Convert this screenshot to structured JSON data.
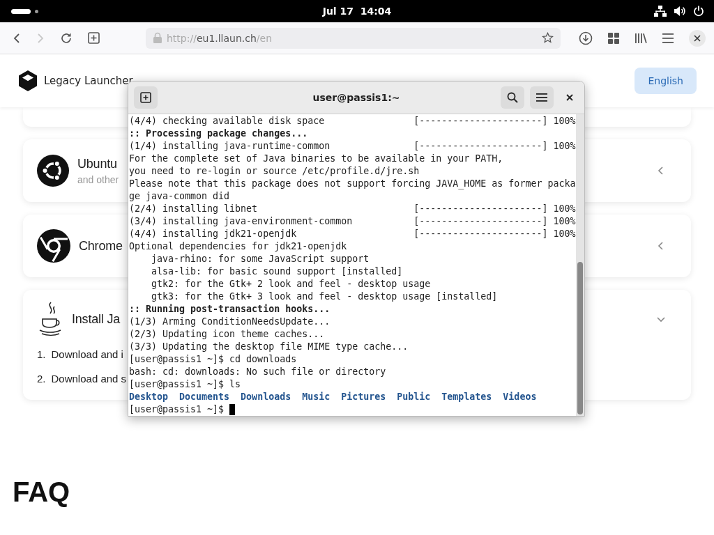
{
  "top_bar": {
    "clock": "Jul 17  14:04"
  },
  "browser": {
    "back_disabled": false,
    "forward_disabled": true,
    "url_scheme": "http://",
    "url_host": "eu1.llaun.ch",
    "url_path": "/en"
  },
  "site": {
    "brand": "Legacy Launcher",
    "language_button": "English",
    "cards": [
      {
        "kind": "ring",
        "title": "Ubuntu",
        "subtitle": "and other",
        "expanded": false
      },
      {
        "kind": "aperture",
        "title": "Chrome",
        "expanded": false
      },
      {
        "kind": "cup",
        "title": "Install Ja",
        "expanded": true,
        "steps": [
          {
            "number": "1.",
            "text": "Download and i"
          },
          {
            "number": "2.",
            "text": "Download and s"
          }
        ]
      }
    ],
    "faq_heading": "FAQ"
  },
  "terminal": {
    "title": "user@passis1:~",
    "lines": [
      {
        "kind": "progress",
        "text": "(4/4) checking available disk space",
        "bar": "[----------------------]",
        "percent": "100%"
      },
      {
        "kind": "bold",
        "text": ":: Processing package changes..."
      },
      {
        "kind": "progress",
        "text": "(1/4) installing java-runtime-common",
        "bar": "[----------------------]",
        "percent": "100%"
      },
      {
        "kind": "text",
        "text": "For the complete set of Java binaries to be available in your PATH,"
      },
      {
        "kind": "text",
        "text": "you need to re-login or source /etc/profile.d/jre.sh"
      },
      {
        "kind": "text",
        "text": "Please note that this package does not support forcing JAVA_HOME as former packa"
      },
      {
        "kind": "text",
        "text": "ge java-common did"
      },
      {
        "kind": "progress",
        "text": "(2/4) installing libnet",
        "bar": "[----------------------]",
        "percent": "100%"
      },
      {
        "kind": "progress",
        "text": "(3/4) installing java-environment-common",
        "bar": "[----------------------]",
        "percent": "100%"
      },
      {
        "kind": "progress",
        "text": "(4/4) installing jdk21-openjdk",
        "bar": "[----------------------]",
        "percent": "100%"
      },
      {
        "kind": "text",
        "text": "Optional dependencies for jdk21-openjdk"
      },
      {
        "kind": "text",
        "text": "    java-rhino: for some JavaScript support"
      },
      {
        "kind": "text",
        "text": "    alsa-lib: for basic sound support [installed]"
      },
      {
        "kind": "text",
        "text": "    gtk2: for the Gtk+ 2 look and feel - desktop usage"
      },
      {
        "kind": "text",
        "text": "    gtk3: for the Gtk+ 3 look and feel - desktop usage [installed]"
      },
      {
        "kind": "bold",
        "text": ":: Running post-transaction hooks..."
      },
      {
        "kind": "text",
        "text": "(1/3) Arming ConditionNeedsUpdate..."
      },
      {
        "kind": "text",
        "text": "(2/3) Updating icon theme caches..."
      },
      {
        "kind": "text",
        "text": "(3/3) Updating the desktop file MIME type cache..."
      },
      {
        "kind": "text",
        "text": "[user@passis1 ~]$ cd downloads"
      },
      {
        "kind": "text",
        "text": "bash: cd: downloads: No such file or directory"
      },
      {
        "kind": "text",
        "text": "[user@passis1 ~]$ ls"
      },
      {
        "kind": "listing",
        "items": [
          "Desktop",
          "Documents",
          "Downloads",
          "Music",
          "Pictures",
          "Public",
          "Templates",
          "Videos"
        ]
      },
      {
        "kind": "prompt",
        "text": "[user@passis1 ~]$ "
      }
    ]
  }
}
